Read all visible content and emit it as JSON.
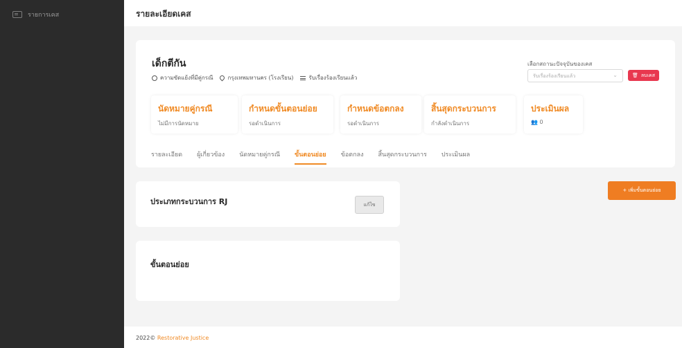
{
  "sidebar": {
    "items": [
      {
        "label": "รายการเคส",
        "icon": "list-icon"
      }
    ]
  },
  "header": {
    "title": "รายละเอียดเคส"
  },
  "case": {
    "name": "เด็กตีกัน",
    "meta": [
      {
        "icon": "dispute-icon",
        "text": "ความขัดแย้งที่มีคู่กรณี"
      },
      {
        "icon": "location-pin-icon",
        "text": "กรุงเทพมหานคร (โรงเรียน)"
      },
      {
        "icon": "list-icon",
        "text": "รับเรื่องร้องเรียนแล้ว"
      }
    ],
    "status_label": "เลือกสถานะปัจจุบันของเคส",
    "status_value": "รับเรื่องร้องเรียนแล้ว",
    "delete_label": "ลบเคส"
  },
  "stats": [
    {
      "title": "นัดหมายคู่กรณี",
      "sub": "ไม่มีการนัดหมาย"
    },
    {
      "title": "กำหนดขั้นตอนย่อย",
      "sub": "รอดำเนินการ"
    },
    {
      "title": "กำหนดข้อตกลง",
      "sub": "รอดำเนินการ"
    },
    {
      "title": "สิ้นสุดกระบวนการ",
      "sub": "กำลังดำเนินการ"
    },
    {
      "title": "ประเมินผล",
      "sub": "0"
    }
  ],
  "tabs": [
    {
      "label": "รายละเอียด"
    },
    {
      "label": "ผู้เกี่ยวข้อง"
    },
    {
      "label": "นัดหมายคู่กรณี"
    },
    {
      "label": "ขั้นตอนย่อย",
      "active": true
    },
    {
      "label": "ข้อตกลง"
    },
    {
      "label": "สิ้นสุดกระบวนการ"
    },
    {
      "label": "ประเมินผล"
    }
  ],
  "process_panel": {
    "title": "ประเภทกระบวนการ RJ",
    "edit_label": "แก้ไข"
  },
  "substeps_panel": {
    "title": "ขั้นตอนย่อย"
  },
  "add_button": "+ เพิ่มขั้นตอนย่อย",
  "footer": {
    "year": "2022©",
    "brand": "Restorative Justice"
  },
  "colors": {
    "accent": "#ef7d22",
    "danger": "#e8384f",
    "sidebar": "#2b2b2b"
  }
}
